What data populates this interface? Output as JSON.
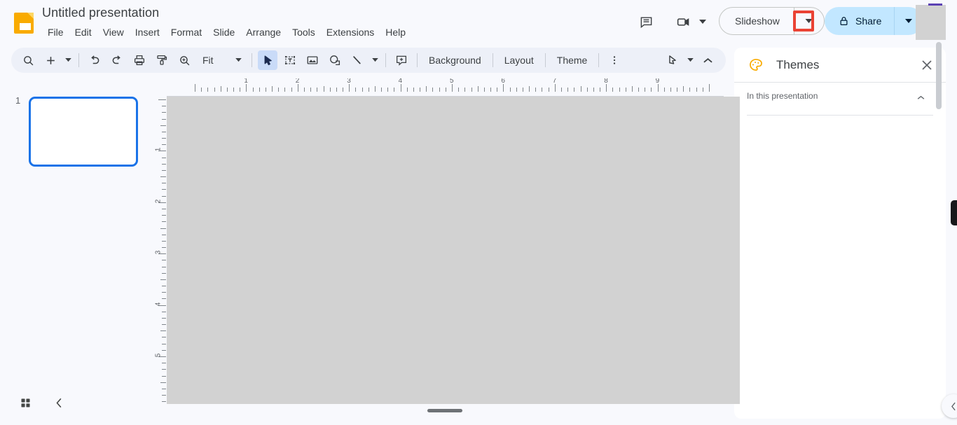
{
  "app": {
    "name": "Google Slides",
    "doc_title": "Untitled presentation",
    "logo_icon": "slides-document-icon"
  },
  "menubar": {
    "items": [
      {
        "label": "File",
        "name": "menu-file"
      },
      {
        "label": "Edit",
        "name": "menu-edit"
      },
      {
        "label": "View",
        "name": "menu-view"
      },
      {
        "label": "Insert",
        "name": "menu-insert"
      },
      {
        "label": "Format",
        "name": "menu-format"
      },
      {
        "label": "Slide",
        "name": "menu-slide"
      },
      {
        "label": "Arrange",
        "name": "menu-arrange"
      },
      {
        "label": "Tools",
        "name": "menu-tools"
      },
      {
        "label": "Extensions",
        "name": "menu-extensions"
      },
      {
        "label": "Help",
        "name": "menu-help"
      }
    ]
  },
  "header_actions": {
    "comment_history_icon": "comment-icon",
    "meet_icon": "video-camera-icon",
    "meet_arrow_icon": "chevron-down-icon",
    "slideshow_label": "Slideshow",
    "slideshow_arrow_icon": "chevron-down-icon",
    "share_label": "Share",
    "share_lock_icon": "lock-icon",
    "share_arrow_icon": "chevron-down-icon",
    "highlight_color": "#ea4335",
    "highlight_target": "slideshow-dropdown-arrow"
  },
  "toolbar": {
    "search_icon": "search-icon",
    "new_slide_icon": "plus-icon",
    "new_slide_arrow_icon": "chevron-down-icon",
    "undo_icon": "undo-icon",
    "redo_icon": "redo-icon",
    "print_icon": "print-icon",
    "paint_format_icon": "paint-format-icon",
    "zoom_icon": "zoom-icon",
    "zoom_value": "Fit",
    "zoom_arrow_icon": "chevron-down-icon",
    "select_icon": "cursor-arrow-icon",
    "textbox_icon": "text-box-icon",
    "image_icon": "image-icon",
    "shape_icon": "shape-icon",
    "line_icon": "line-icon",
    "line_arrow_icon": "chevron-down-icon",
    "comment_icon": "add-comment-icon",
    "background_label": "Background",
    "layout_label": "Layout",
    "theme_label": "Theme",
    "more_icon": "more-vertical-icon",
    "laser_icon": "laser-pointer-icon",
    "laser_arrow_icon": "chevron-down-icon",
    "collapse_icon": "chevron-up-icon"
  },
  "filmstrip": {
    "slides": [
      {
        "number": "1",
        "selected": true
      }
    ],
    "grid_view_icon": "grid-view-icon",
    "collapse_icon": "chevron-left-icon"
  },
  "rulers": {
    "horizontal_labels": [
      "1",
      "2",
      "3",
      "4",
      "5",
      "6",
      "7",
      "8",
      "9"
    ],
    "vertical_labels": [
      "1",
      "2",
      "3",
      "4",
      "5"
    ],
    "unit": "inches"
  },
  "canvas": {
    "slide_background": "#ffffff",
    "overlay_color": "#d2d2d2",
    "scrollbar_name": "horizontal-scrollbar"
  },
  "themes_panel": {
    "title": "Themes",
    "palette_icon": "palette-icon",
    "close_icon": "close-icon",
    "section_label": "In this presentation",
    "section_arrow_icon": "chevron-up-icon"
  },
  "right_rail": {
    "handle_name": "panel-resize-handle",
    "collapse_icon": "chevron-left-icon"
  },
  "colors": {
    "brand_yellow": "#f9ab00",
    "accent_blue": "#1a73e8",
    "share_bg": "#c2e7ff",
    "toolbar_bg": "#edf0f8",
    "page_bg": "#f8f9fd",
    "highlight_red": "#ea4335"
  }
}
